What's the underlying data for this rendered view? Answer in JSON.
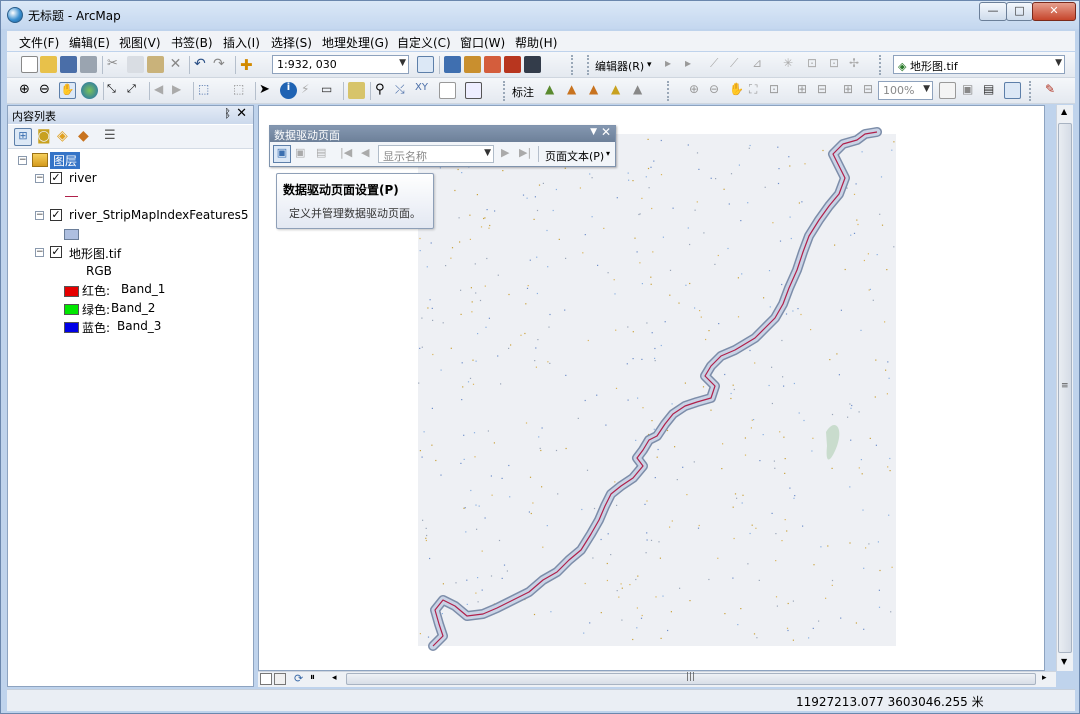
{
  "window": {
    "title": "无标题 - ArcMap"
  },
  "menubar": {
    "items": [
      "文件(F)",
      "编辑(E)",
      "视图(V)",
      "书签(B)",
      "插入(I)",
      "选择(S)",
      "地理处理(G)",
      "自定义(C)",
      "窗口(W)",
      "帮助(H)"
    ]
  },
  "toolbar": {
    "scale_value": "1:932, 030",
    "editor_label": "编辑器(R)",
    "layer_combo": "地形图.tif",
    "annotate_label": "标注",
    "zoom_value": "100%"
  },
  "toc": {
    "title": "内容列表",
    "group_label": "图层",
    "layers": [
      {
        "name": "river",
        "checked": true
      },
      {
        "name": "river_StripMapIndexFeatures5",
        "checked": true
      },
      {
        "name": "地形图.tif",
        "checked": true
      }
    ],
    "raster_mode": "RGB",
    "bands": [
      {
        "label": "红色:",
        "band": "Band_1",
        "color": "#e60000"
      },
      {
        "label": "绿色:",
        "band": "Band_2",
        "color": "#00e600"
      },
      {
        "label": "蓝色:",
        "band": "Band_3",
        "color": "#0000e6"
      }
    ]
  },
  "ddp": {
    "title": "数据驱动页面",
    "name_combo": "显示名称",
    "page_text_label": "页面文本(P)"
  },
  "tooltip": {
    "title": "数据驱动页面设置(P)",
    "body": "定义并管理数据驱动页面。"
  },
  "status": {
    "coords": "11927213.077  3603046.255 米"
  },
  "colors": {
    "river": "#b0204a",
    "strip": "#aebfe0",
    "raster_bg": "#eef0f4"
  }
}
